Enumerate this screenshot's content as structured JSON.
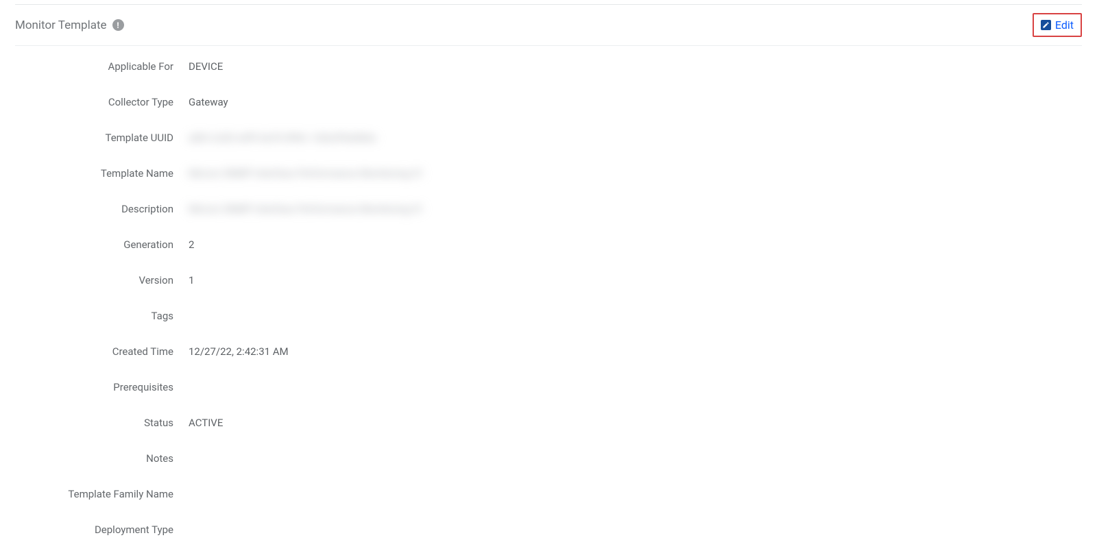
{
  "header": {
    "title": "Monitor Template",
    "info_glyph": "!",
    "edit_label": "Edit"
  },
  "fields": [
    {
      "label": "Applicable For",
      "value": "DEVICE"
    },
    {
      "label": "Collector Type",
      "value": "Gateway"
    },
    {
      "label": "Template UUID",
      "value": "a0b1c2d3 e4f5 6a7b 890c 1d2e3f4a5b6c",
      "blurred": true
    },
    {
      "label": "Template Name",
      "value": "Micron SNMP Interface Performance Monitoring 01",
      "blurred": true
    },
    {
      "label": "Description",
      "value": "Micron SNMP Interface Performance Monitoring 01",
      "blurred": true
    },
    {
      "label": "Generation",
      "value": "2"
    },
    {
      "label": "Version",
      "value": "1"
    },
    {
      "label": "Tags",
      "value": ""
    },
    {
      "label": "Created Time",
      "value": "12/27/22, 2:42:31 AM"
    },
    {
      "label": "Prerequisites",
      "value": ""
    },
    {
      "label": "Status",
      "value": "ACTIVE"
    },
    {
      "label": "Notes",
      "value": ""
    },
    {
      "label": "Template Family Name",
      "value": ""
    },
    {
      "label": "Deployment Type",
      "value": ""
    }
  ]
}
